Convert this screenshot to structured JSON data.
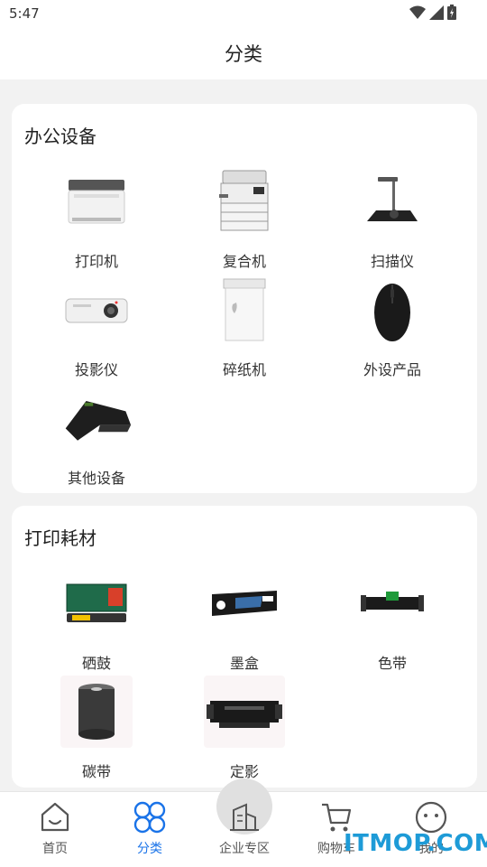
{
  "status_bar": {
    "time": "5:47"
  },
  "header": {
    "title": "分类"
  },
  "sections": [
    {
      "title": "办公设备",
      "items": [
        {
          "label": "打印机",
          "icon": "printer-icon"
        },
        {
          "label": "复合机",
          "icon": "multifunction-printer-icon"
        },
        {
          "label": "扫描仪",
          "icon": "scanner-icon"
        },
        {
          "label": "投影仪",
          "icon": "projector-icon"
        },
        {
          "label": "碎纸机",
          "icon": "shredder-icon"
        },
        {
          "label": "外设产品",
          "icon": "mouse-icon"
        },
        {
          "label": "其他设备",
          "icon": "barcode-scanner-icon"
        }
      ]
    },
    {
      "title": "打印耗材",
      "items": [
        {
          "label": "硒鼓",
          "icon": "toner-cartridge-icon"
        },
        {
          "label": "墨盒",
          "icon": "ink-cartridge-icon"
        },
        {
          "label": "色带",
          "icon": "ribbon-cartridge-icon"
        },
        {
          "label": "碳带",
          "icon": "carbon-ribbon-roll-icon"
        },
        {
          "label": "定影",
          "icon": "fuser-icon"
        }
      ]
    }
  ],
  "tabbar": {
    "items": [
      {
        "label": "首页",
        "icon": "home-icon"
      },
      {
        "label": "分类",
        "icon": "category-icon",
        "active": true
      },
      {
        "label": "企业专区",
        "icon": "building-icon"
      },
      {
        "label": "购物车",
        "icon": "cart-icon"
      },
      {
        "label": "我的",
        "icon": "smile-icon"
      }
    ],
    "active_color": "#1a73e8"
  },
  "watermark": "ITMOP.COM"
}
